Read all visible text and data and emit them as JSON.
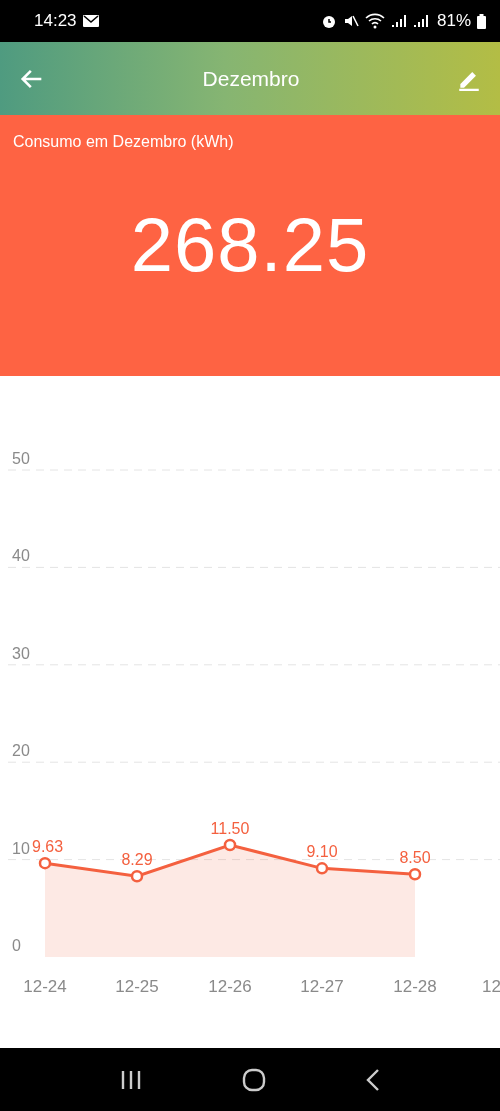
{
  "status_bar": {
    "time": "14:23",
    "battery": "81%"
  },
  "header": {
    "title": "Dezembro"
  },
  "summary": {
    "label": "Consumo em Dezembro (kWh)",
    "value": "268.25"
  },
  "chart": {
    "chart_data": {
      "type": "area",
      "categories": [
        "12-24",
        "12-25",
        "12-26",
        "12-27",
        "12-28"
      ],
      "series": [
        {
          "color": "#f4603f",
          "values": [
            9.63,
            8.29,
            11.5,
            9.1,
            8.5
          ]
        }
      ],
      "ylim": [
        0,
        50
      ],
      "yticks": [
        0,
        10,
        20,
        30,
        40,
        50
      ],
      "grid": true,
      "value_labels": [
        "9.63",
        "8.29",
        "11.50",
        "9.10",
        "8.50"
      ]
    },
    "cut_axis_label": "12"
  }
}
